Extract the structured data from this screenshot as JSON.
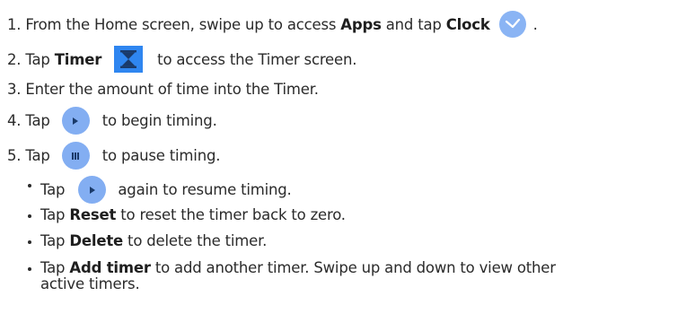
{
  "steps": [
    {
      "num": "1.",
      "pre": "From the Home screen, swipe up to access ",
      "bold1": "Apps",
      "mid": " and tap ",
      "bold2": "Clock",
      "icon": "clock-app-icon",
      "post": "."
    },
    {
      "num": "2.",
      "pre": "Tap ",
      "bold": "Timer",
      "icon": "hourglass-icon",
      "post": "to access the Timer screen."
    },
    {
      "num": "3.",
      "text": "Enter the amount of time into the Timer."
    },
    {
      "num": "4.",
      "pre": "Tap ",
      "icon": "play-icon",
      "post": "to begin timing."
    },
    {
      "num": "5.",
      "pre": "Tap ",
      "icon": "pause-icon",
      "post": "to pause timing."
    }
  ],
  "bullets": [
    {
      "pre": "Tap ",
      "icon": "play-icon",
      "post": "again to resume timing."
    },
    {
      "pre": "Tap ",
      "bold": "Reset",
      "post": " to reset the timer back to zero."
    },
    {
      "pre": "Tap ",
      "bold": "Delete",
      "post": " to delete the timer."
    },
    {
      "pre": "Tap ",
      "bold": "Add timer",
      "post": " to add another timer. Swipe up and down to view other",
      "post2": "active timers."
    }
  ],
  "colors": {
    "text": "#2b2b2b",
    "button_blue": "#83aef2",
    "timer_icon_blue": "#2f86f0",
    "icon_glyph": "#1a3a6a"
  }
}
